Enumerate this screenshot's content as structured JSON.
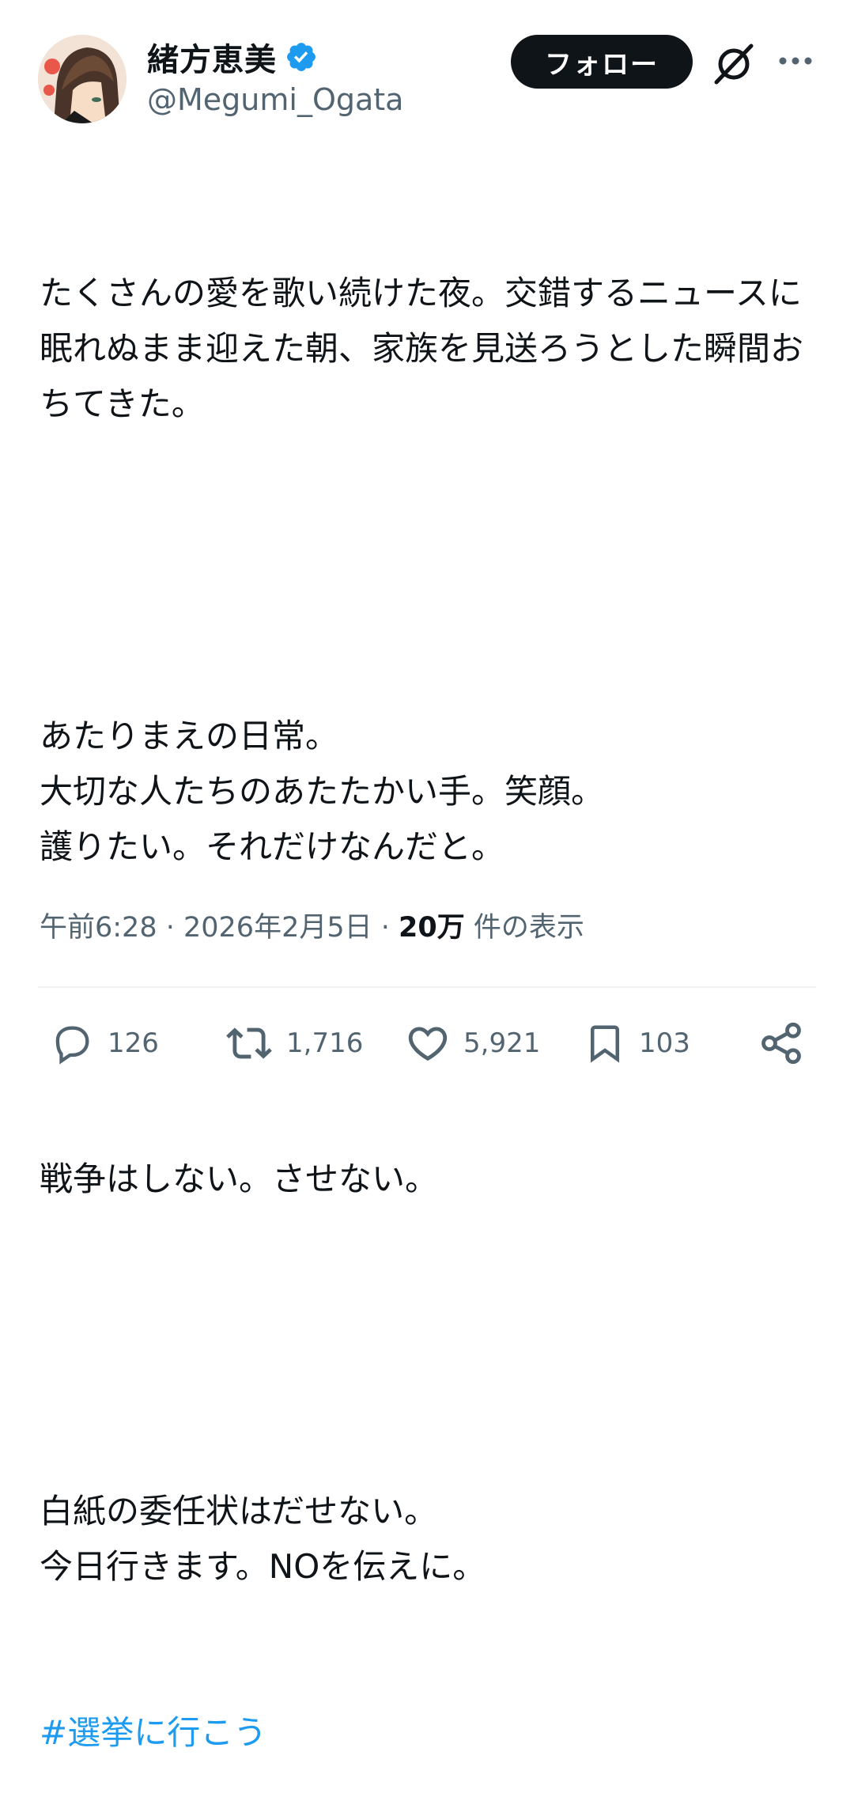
{
  "author": {
    "display_name": "緒方恵美",
    "handle": "@Megumi_Ogata",
    "verified": true
  },
  "header": {
    "follow_label": "フォロー"
  },
  "tweet": {
    "paragraphs": [
      "たくさんの愛を歌い続けた夜。交錯するニュースに眠れぬまま迎えた朝、家族を見送ろうとした瞬間おちてきた。",
      "あたりまえの日常。\n大切な人たちのあたたかい手。笑顔。\n護りたい。それだけなんだと。",
      "戦争はしない。させない。",
      "白紙の委任状はだせない。\n今日行きます。NOを伝えに。"
    ],
    "hashtag": "#選挙に行こう"
  },
  "meta": {
    "time": "午前6:28",
    "separator": " · ",
    "date": "2026年2月5日",
    "views_count": "20万",
    "views_label": "件の表示"
  },
  "actions": {
    "replies": "126",
    "reposts": "1,716",
    "likes": "5,921",
    "bookmarks": "103"
  },
  "colors": {
    "text": "#0f1419",
    "secondary": "#536471",
    "link": "#1d9bf0",
    "verified": "#1d9bf0",
    "follow_bg": "#0f1419"
  },
  "icons": [
    "verified-badge-icon",
    "grok-icon",
    "more-icon",
    "reply-icon",
    "repost-icon",
    "like-icon",
    "bookmark-icon",
    "share-icon"
  ]
}
